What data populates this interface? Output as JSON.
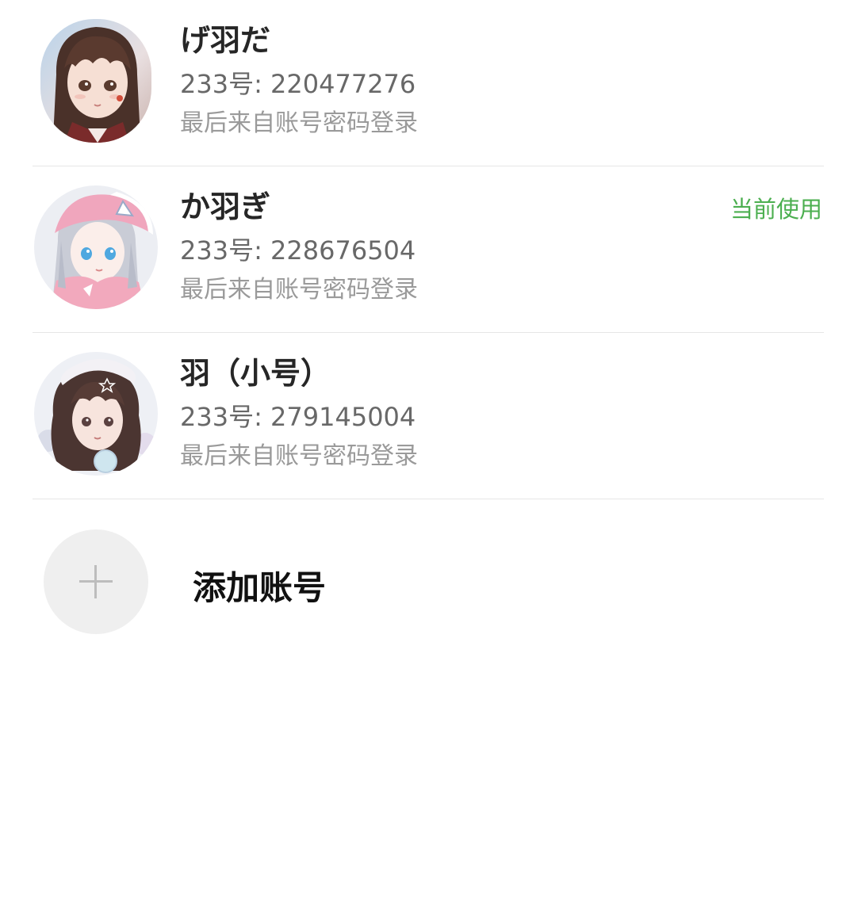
{
  "accounts": [
    {
      "name": "げ羽だ",
      "id_label": "233号: 220477276",
      "source": "最后来自账号密码登录",
      "current_badge": ""
    },
    {
      "name": "か羽ぎ",
      "id_label": "233号: 228676504",
      "source": "最后来自账号密码登录",
      "current_badge": "当前使用"
    },
    {
      "name": "羽（小号）",
      "id_label": "233号: 279145004",
      "source": "最后来自账号密码登录",
      "current_badge": ""
    }
  ],
  "add_account": {
    "label": "添加账号",
    "icon": "plus-icon"
  },
  "colors": {
    "current_badge": "#4caf50",
    "divider": "#e6e6e6",
    "add_circle": "#efefef"
  }
}
